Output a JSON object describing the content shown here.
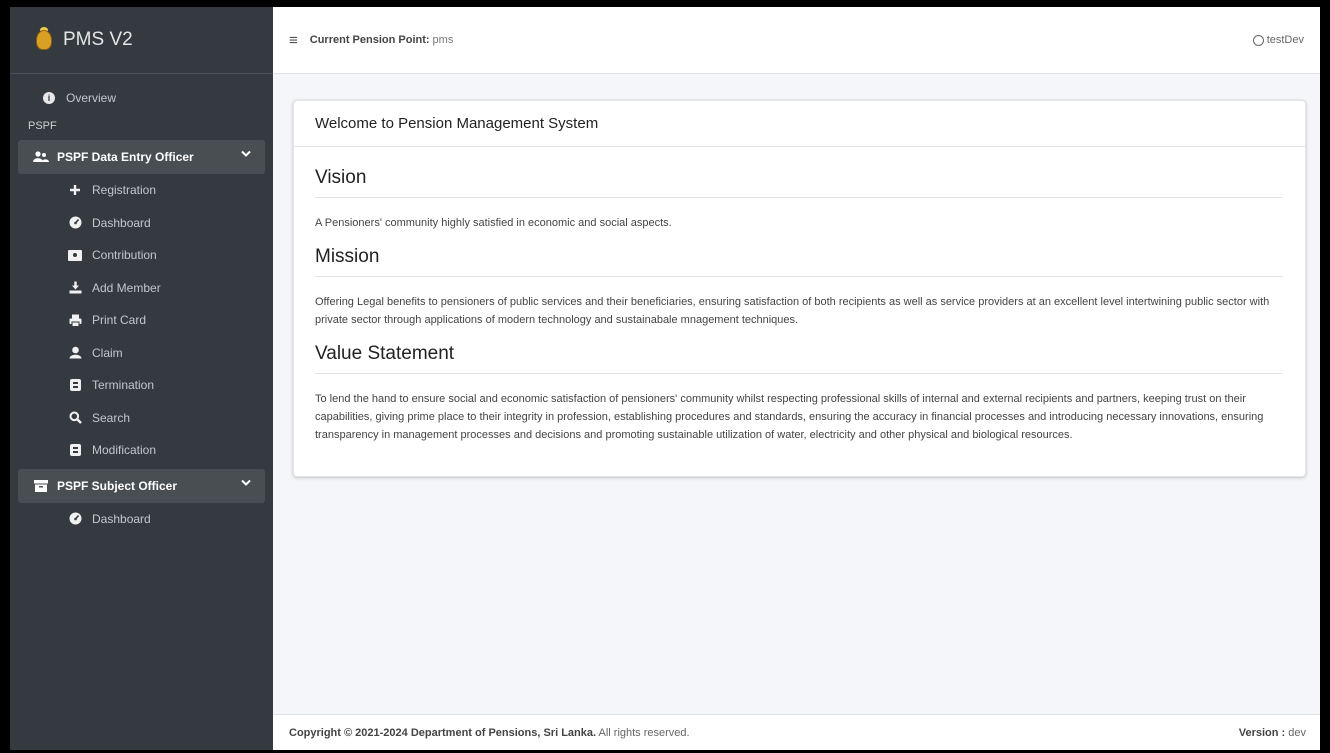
{
  "brand": {
    "title": "PMS V2"
  },
  "sidebar": {
    "overview": "Overview",
    "section_header": "PSPF",
    "groups": [
      {
        "label": "PSPF Data Entry Officer",
        "items": [
          {
            "label": "Registration",
            "icon": "plus-icon"
          },
          {
            "label": "Dashboard",
            "icon": "tachometer-icon"
          },
          {
            "label": "Contribution",
            "icon": "money-icon"
          },
          {
            "label": "Add Member",
            "icon": "download-icon"
          },
          {
            "label": "Print Card",
            "icon": "print-icon"
          },
          {
            "label": "Claim",
            "icon": "user-claim-icon"
          },
          {
            "label": "Termination",
            "icon": "square-icon"
          },
          {
            "label": "Search",
            "icon": "search-icon"
          },
          {
            "label": "Modification",
            "icon": "square-icon"
          }
        ]
      },
      {
        "label": "PSPF Subject Officer",
        "items": [
          {
            "label": "Dashboard",
            "icon": "tachometer-icon"
          }
        ]
      }
    ]
  },
  "header": {
    "pension_point_label": "Current Pension Point:",
    "pension_point_value": "pms",
    "user": "testDev"
  },
  "card": {
    "title": "Welcome to Pension Management System",
    "sections": [
      {
        "heading": "Vision",
        "text": "A Pensioners' community highly satisfied in economic and social aspects."
      },
      {
        "heading": "Mission",
        "text": "Offering Legal benefits to pensioners of public services and their beneficiaries, ensuring satisfaction of both recipients as well as service providers at an excellent level intertwining public sector with private sector through applications of modern technology and sustainabale mnagement techniques."
      },
      {
        "heading": "Value Statement",
        "text": "To lend the hand to ensure social and economic satisfaction of pensioners' community whilst respecting professional skills of internal and external recipients and partners, keeping trust on their capabilities, giving prime place to their integrity in profession, establishing procedures and standards, ensuring the accuracy in financial processes and introducing necessary innovations, ensuring transparency in management processes and decisions and promoting sustainable utilization of water, electricity and other physical and biological resources."
      }
    ]
  },
  "footer": {
    "copyright_prefix": "Copyright © 2021-2024",
    "organization": "Department of Pensions, Sri Lanka.",
    "rights": "All rights reserved.",
    "version_label": "Version :",
    "version_value": "dev"
  },
  "colors": {
    "sidebar_bg": "#343a40",
    "active_group_bg": "#494e53",
    "page_bg": "#f4f6f9"
  }
}
